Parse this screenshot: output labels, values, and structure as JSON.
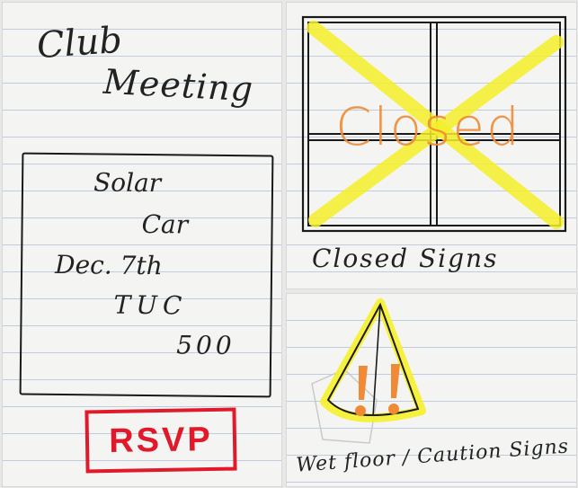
{
  "flyer": {
    "title_line1": "Club",
    "title_line2": "Meeting",
    "line1": "Solar",
    "line2": "Car",
    "line3": "Dec. 7th",
    "line4": "TUC",
    "line5": "500",
    "rsvp": "RSVP"
  },
  "closed_sign": {
    "word": "Closed",
    "caption": "Closed Signs"
  },
  "caution_sign": {
    "symbol": "!!",
    "caption": "Wet floor / Caution Signs"
  },
  "colors": {
    "rsvp_red": "#e01a2b",
    "highlighter_yellow": "#f6f02a",
    "closed_orange": "#f08a36"
  }
}
